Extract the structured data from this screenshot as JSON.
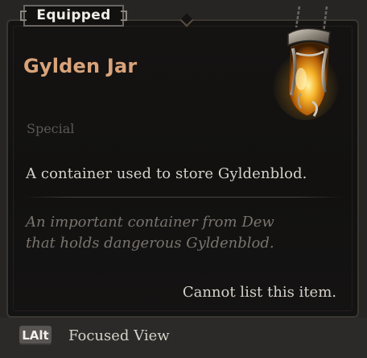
{
  "badge": {
    "label": "Equipped"
  },
  "item": {
    "name": "Gylden Jar",
    "category": "Special",
    "description": "A container used to store Gyldenblod.",
    "lore_lines": [
      "An important container from Dew",
      "that holds dangerous Gyldenblod."
    ],
    "trade_note": "Cannot list this item.",
    "icon": "gylden-jar-icon"
  },
  "footer": {
    "key": "LAlt",
    "action": "Focused View"
  },
  "colors": {
    "title": "#d9a37a",
    "body_text": "#d6d1ca",
    "lore_text": "#7a746e",
    "category_text": "#5c5853",
    "panel_bg": "#141312",
    "footer_bg": "#2b2a28",
    "gem_glow": "#f2a31c"
  }
}
